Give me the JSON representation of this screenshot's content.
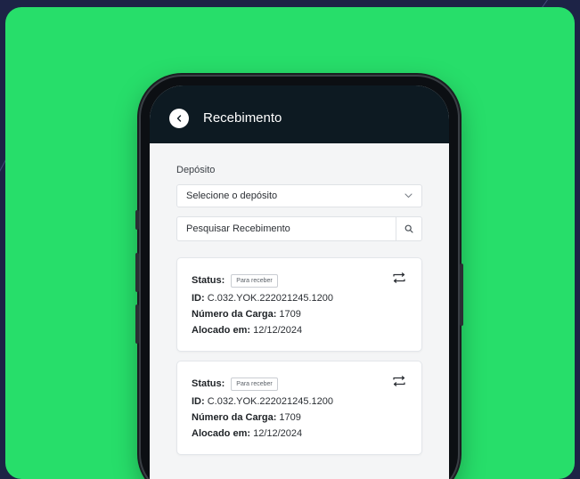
{
  "app": {
    "title": "Recebimento"
  },
  "filters": {
    "deposit_label": "Depósito",
    "deposit_select_value": "Selecione o depósito",
    "search_placeholder": "Pesquisar Recebimento"
  },
  "receipts": [
    {
      "status_label": "Status:",
      "status_value": "Para receber",
      "id_label": "ID:",
      "id_value": "C.032.YOK.222021245.1200",
      "load_label": "Número da Carga:",
      "load_value": "1709",
      "allocated_label": "Alocado em:",
      "allocated_value": "12/12/2024"
    },
    {
      "status_label": "Status:",
      "status_value": "Para receber",
      "id_label": "ID:",
      "id_value": "C.032.YOK.222021245.1200",
      "load_label": "Número da Carga:",
      "load_value": "1709",
      "allocated_label": "Alocado em:",
      "allocated_value": "12/12/2024"
    }
  ],
  "icons": {
    "back": "chevron-left-icon",
    "select": "chevron-down-icon",
    "search": "search-icon",
    "card_action": "swap-icon"
  },
  "colors": {
    "background": "#1d2346",
    "accent_green": "#27de6a",
    "appbar": "#0d1a22",
    "screen": "#f4f5f6"
  }
}
